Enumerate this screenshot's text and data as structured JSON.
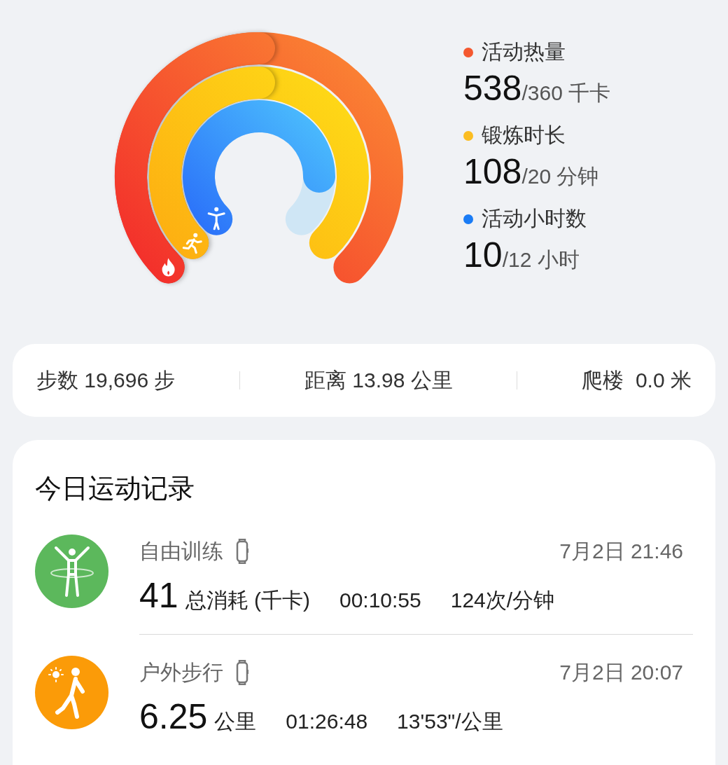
{
  "rings": [
    {
      "kind": "calories",
      "label": "活动热量",
      "value": "538",
      "goal": "/360 千卡",
      "color": "#f4582f"
    },
    {
      "kind": "exercise",
      "label": "锻炼时长",
      "value": "108",
      "goal": "/20 分钟",
      "color": "#fbbd22"
    },
    {
      "kind": "stand",
      "label": "活动小时数",
      "value": "10",
      "goal": "/12 小时",
      "color": "#1a7cf5"
    }
  ],
  "stats": [
    "步数 19,696 步",
    "距离 13.98 公里",
    "爬楼  0.0 米"
  ],
  "records": {
    "title": "今日运动记录",
    "items": [
      {
        "kind": "training",
        "name": "自由训练",
        "time": "7月2日 21:46",
        "main_value": "41",
        "main_unit": "总消耗 (千卡)",
        "duration": "00:10:55",
        "rate": "124次/分钟"
      },
      {
        "kind": "walk",
        "name": "户外步行",
        "time": "7月2日 20:07",
        "main_value": "6.25",
        "main_unit": "公里",
        "duration": "01:26:48",
        "rate": "13'53\"/公里"
      }
    ]
  }
}
